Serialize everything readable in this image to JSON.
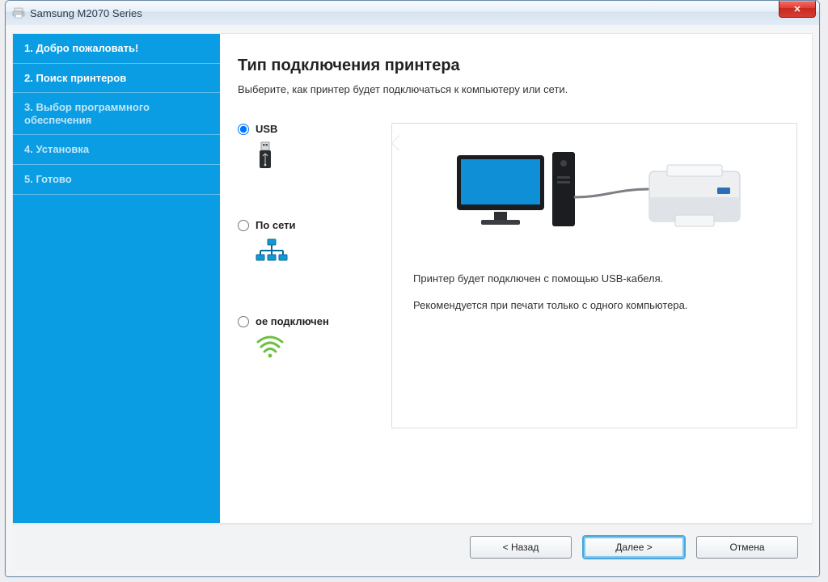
{
  "window": {
    "title": "Samsung M2070 Series"
  },
  "sidebar": {
    "steps": [
      "1. Добро пожаловать!",
      "2. Поиск принтеров",
      "3. Выбор программного обеспечения",
      "4. Установка",
      "5. Готово"
    ],
    "active_index": 1
  },
  "main": {
    "heading": "Тип подключения принтера",
    "subtitle": "Выберите, как принтер будет подключаться к компьютеру или сети."
  },
  "options": {
    "usb": {
      "label": "USB",
      "selected": true
    },
    "network": {
      "label": "По сети",
      "selected": false
    },
    "wireless": {
      "label": "ое подключен",
      "selected": false
    }
  },
  "info": {
    "line1": "Принтер будет подключен с помощью USB-кабеля.",
    "line2": "Рекомендуется при печати только с одного компьютера."
  },
  "buttons": {
    "back": "< Назад",
    "next": "Далее >",
    "cancel": "Отмена"
  }
}
